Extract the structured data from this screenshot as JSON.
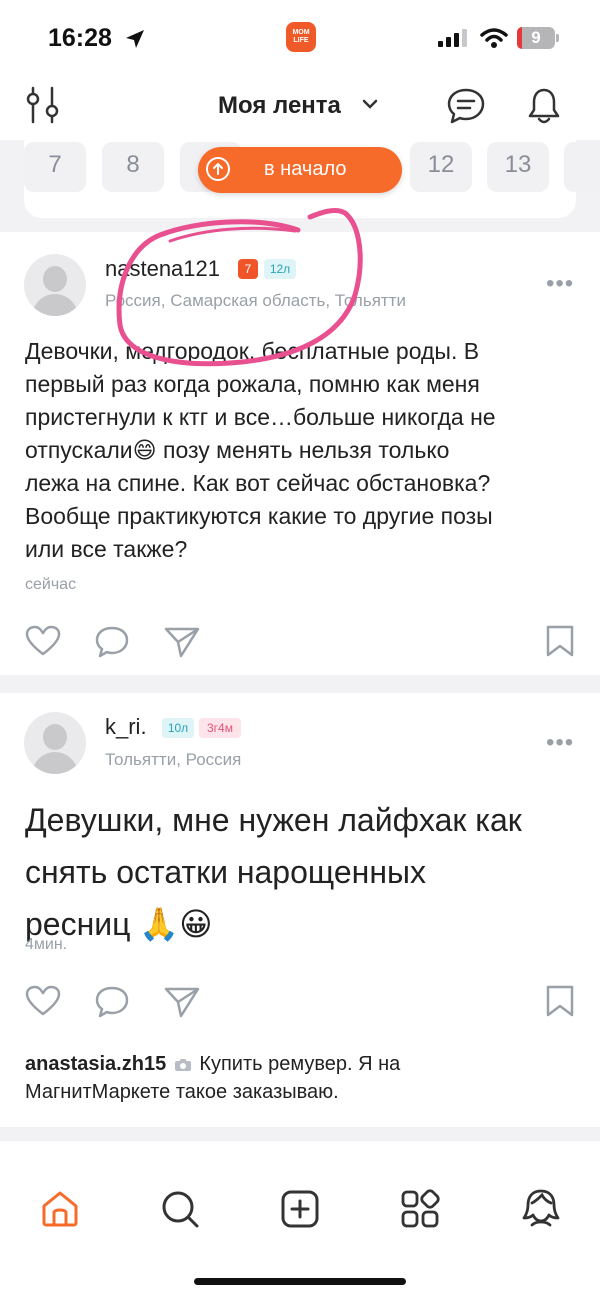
{
  "status_bar": {
    "time": "16:28",
    "battery": "9",
    "app_badge_text": "MOM LIFE"
  },
  "header": {
    "title": "Моя лента"
  },
  "calendar": {
    "days": [
      "7",
      "8",
      "12",
      "13"
    ],
    "go_top_label": "в начало"
  },
  "posts": [
    {
      "username": "nastena121",
      "level_badge": "7",
      "age_badge": "12л",
      "location": "Россия, Самарская область, Тольятти",
      "text_lines": [
        "Девочки, медгородок, бесплатные роды. В",
        "первый раз когда рожала, помню как меня",
        "пристегнули к ктг и все…больше никогда не",
        "отпускали😄 позу менять нельзя только",
        "лежа на спине. Как вот сейчас обстановка?",
        "Вообще практикуются какие то другие позы",
        "или все также?"
      ],
      "time": "сейчас"
    },
    {
      "username": "k_ri.",
      "age_badge": "10л",
      "child_badge": "3г4м",
      "location": "Тольятти, Россия",
      "text_lines": [
        "Девушки, мне нужен лайфхак как",
        "снять остатки нарощенных",
        "ресниц 🙏😀"
      ],
      "time": "4мин.",
      "comment": {
        "author": "anastasia.zh15",
        "text_line1": "Купить ремувер. Я на",
        "text_line2": "МагнитМаркете такое заказываю."
      }
    }
  ],
  "colors": {
    "accent": "#f66a2a",
    "scribble": "#e8508f",
    "muted_text": "#9aa0a8"
  },
  "icons": [
    "filter-icon",
    "chevron-down-icon",
    "chat-icon",
    "bell-icon",
    "like-icon",
    "comment-icon",
    "share-icon",
    "bookmark-icon",
    "home-icon",
    "search-icon",
    "add-icon",
    "services-icon",
    "profile-icon"
  ]
}
